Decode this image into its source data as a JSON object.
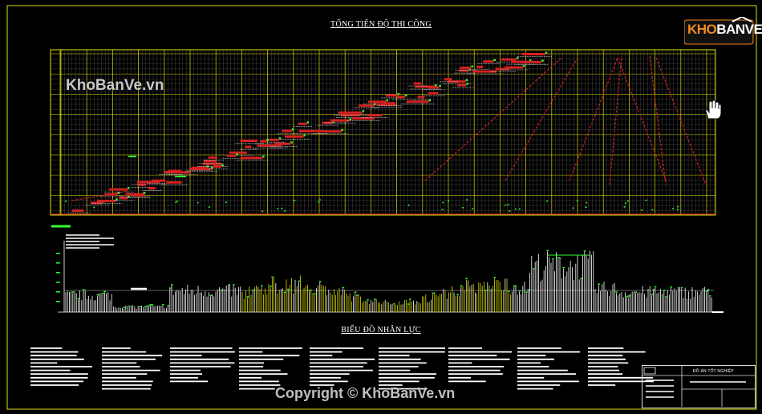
{
  "drawing": {
    "top_title": "TỔNG TIẾN ĐỘ THI CÔNG",
    "bottom_title": "BIỂU ĐỒ NHÂN LỰC",
    "watermark_top": "KhoBanVe.vn",
    "watermark_bottom": "Copyright © KhoBanVe.vn",
    "logo_part1": "KHO",
    "logo_part2": "BANVE",
    "titleblock_label": "ĐỒ ÁN TỐT NGHIỆP"
  },
  "colors": {
    "background": "#000000",
    "grid_yellow": "#e6e600",
    "grid_grey": "#8c8c8c",
    "task_red": "#d42020",
    "marker_green": "#33ff33",
    "histogram_yellow": "#d8d800",
    "histogram_white": "#ffffff",
    "logo_orange": "#f18a1f"
  },
  "icons": [
    "hand-cursor-icon",
    "house-logo-icon"
  ]
}
